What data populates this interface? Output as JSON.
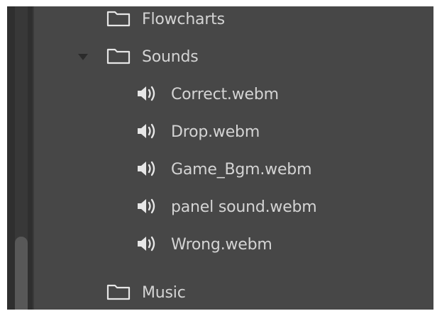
{
  "tree": {
    "folders": [
      {
        "label": "Flowcharts",
        "expanded": false,
        "icon": "folder-icon"
      },
      {
        "label": "Sounds",
        "expanded": true,
        "icon": "folder-icon"
      },
      {
        "label": "Music",
        "expanded": false,
        "icon": "folder-icon"
      }
    ],
    "sounds_files": [
      {
        "label": "Correct.webm",
        "icon": "speaker-icon"
      },
      {
        "label": "Drop.webm",
        "icon": "speaker-icon"
      },
      {
        "label": "Game_Bgm.webm",
        "icon": "speaker-icon"
      },
      {
        "label": "panel sound.webm",
        "icon": "speaker-icon"
      },
      {
        "label": "Wrong.webm",
        "icon": "speaker-icon"
      }
    ]
  },
  "colors": {
    "panel_bg": "#474747",
    "text": "#d4d4d4",
    "icon": "#e6e6e6",
    "caret": "#2b2b2b"
  }
}
